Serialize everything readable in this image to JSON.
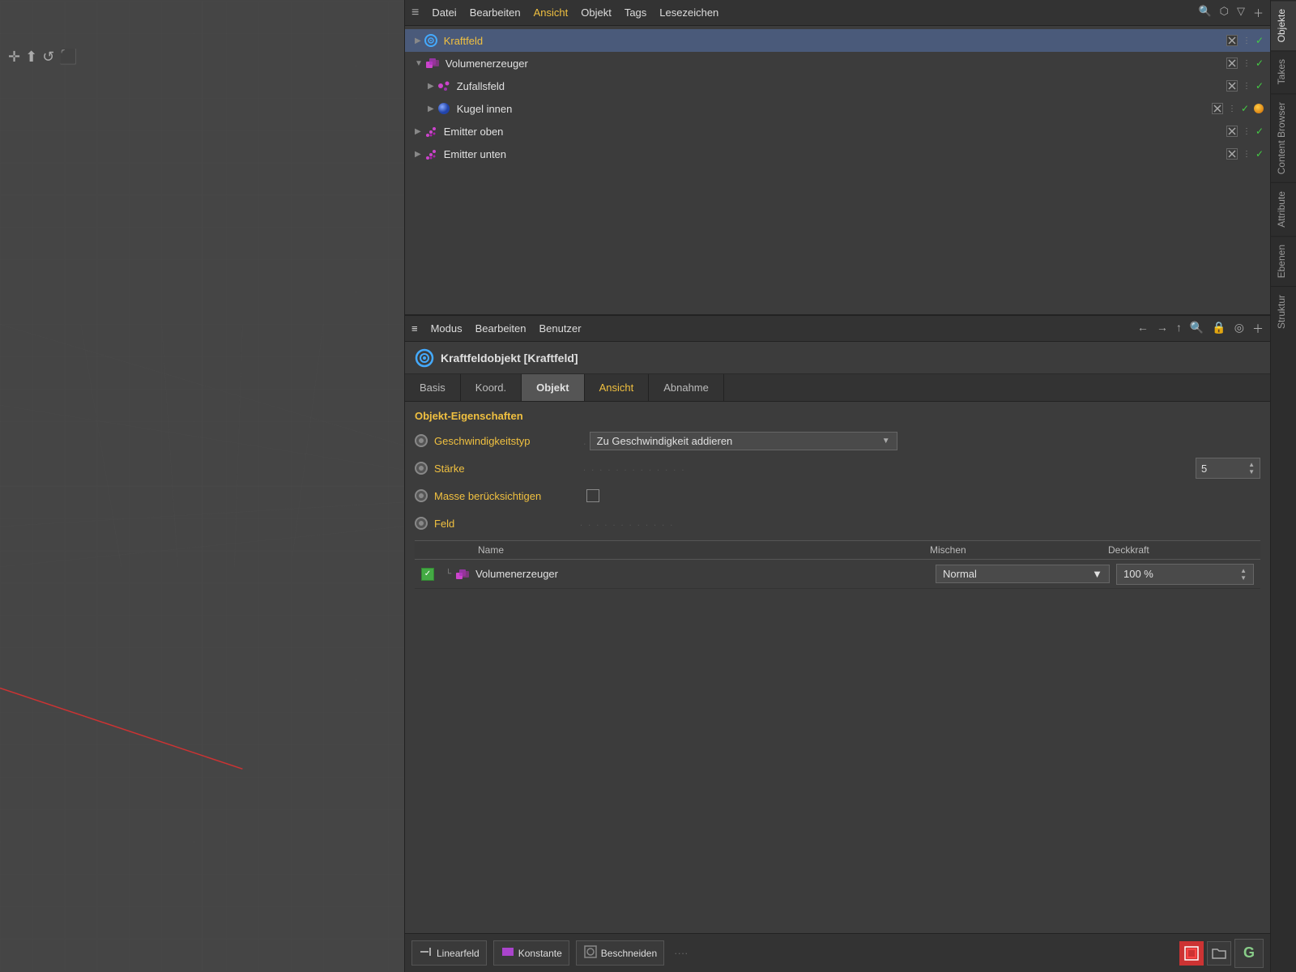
{
  "topMenu": {
    "icon": "≡",
    "items": [
      "Datei",
      "Bearbeiten",
      "Ansicht",
      "Objekt",
      "Tags",
      "Lesezeichen"
    ],
    "activeItem": "Ansicht",
    "rightIcons": [
      "🔍",
      "⬡",
      "▽",
      "＋"
    ]
  },
  "objectList": {
    "title": "Objekte",
    "items": [
      {
        "id": "kraftfeld",
        "label": "Kraftfeld",
        "indent": 0,
        "iconType": "force-field",
        "selected": true,
        "hasArrow": false,
        "expanded": false,
        "nameColor": "yellow"
      },
      {
        "id": "volumenerzeuger",
        "label": "Volumenerzeuger",
        "indent": 0,
        "iconType": "volume",
        "selected": false,
        "hasArrow": true,
        "expanded": true,
        "nameColor": "normal"
      },
      {
        "id": "zufallsfeld",
        "label": "Zufallsfeld",
        "indent": 1,
        "iconType": "random",
        "selected": false,
        "hasArrow": false,
        "expanded": false,
        "nameColor": "normal"
      },
      {
        "id": "kugel-innen",
        "label": "Kugel innen",
        "indent": 1,
        "iconType": "sphere",
        "selected": false,
        "hasArrow": false,
        "expanded": false,
        "nameColor": "normal",
        "hasOrangeDot": true
      },
      {
        "id": "emitter-oben",
        "label": "Emitter oben",
        "indent": 0,
        "iconType": "emitter",
        "selected": false,
        "hasArrow": false,
        "expanded": false,
        "nameColor": "normal"
      },
      {
        "id": "emitter-unten",
        "label": "Emitter unten",
        "indent": 0,
        "iconType": "emitter",
        "selected": false,
        "hasArrow": false,
        "expanded": false,
        "nameColor": "normal"
      }
    ]
  },
  "attrMenu": {
    "icon": "≡",
    "items": [
      "Modus",
      "Bearbeiten",
      "Benutzer"
    ],
    "rightIcons": [
      "←",
      "→",
      "↑",
      "🔍",
      "🔒",
      "◎",
      "＋"
    ]
  },
  "objectTitle": {
    "label": "Kraftfeldobjekt [Kraftfeld]"
  },
  "tabs": {
    "items": [
      "Basis",
      "Koord.",
      "Objekt",
      "Ansicht",
      "Abnahme"
    ],
    "activeTab": "Objekt",
    "yellowTab": "Ansicht"
  },
  "properties": {
    "sectionTitle": "Objekt-Eigenschaften",
    "rows": [
      {
        "id": "geschwindigkeitstyp",
        "label": "Geschwindigkeitstyp",
        "dots": ".",
        "controlType": "dropdown",
        "value": "Zu Geschwindigkeit addieren"
      },
      {
        "id": "staerke",
        "label": "Stärke",
        "dots": ". . . . . . . . . . . . .",
        "controlType": "spinbox",
        "value": "5"
      },
      {
        "id": "masse",
        "label": "Masse berücksichtigen",
        "dots": "",
        "controlType": "checkbox",
        "value": ""
      },
      {
        "id": "feld",
        "label": "Feld",
        "dots": ". . . . . . . . . . . .",
        "controlType": "none",
        "value": ""
      }
    ]
  },
  "fieldTable": {
    "headers": {
      "name": "Name",
      "mix": "Mischen",
      "opacity": "Deckkraft"
    },
    "rows": [
      {
        "id": "vol-row",
        "checked": true,
        "objectName": "Volumenerzeuger",
        "mixValue": "Normal",
        "opacityValue": "100 %"
      }
    ]
  },
  "bottomToolbar": {
    "tools": [
      {
        "id": "linearfeld",
        "icon": "→|",
        "label": "Linearfeld"
      },
      {
        "id": "konstante",
        "icon": "■",
        "label": "Konstante",
        "color": "#aa44cc"
      },
      {
        "id": "beschneiden",
        "icon": "◻",
        "label": "Beschneiden"
      }
    ],
    "rightTools": [
      {
        "id": "select-tool",
        "icon": "⊡",
        "active": true
      },
      {
        "id": "folder-tool",
        "icon": "📁",
        "active": false
      }
    ],
    "gButton": "G"
  },
  "rightSidebar": {
    "tabs": [
      "Objekte",
      "Takes",
      "Content Browser",
      "Attribute",
      "Ebenen",
      "Struktur"
    ],
    "activeTab": "Objekte"
  }
}
